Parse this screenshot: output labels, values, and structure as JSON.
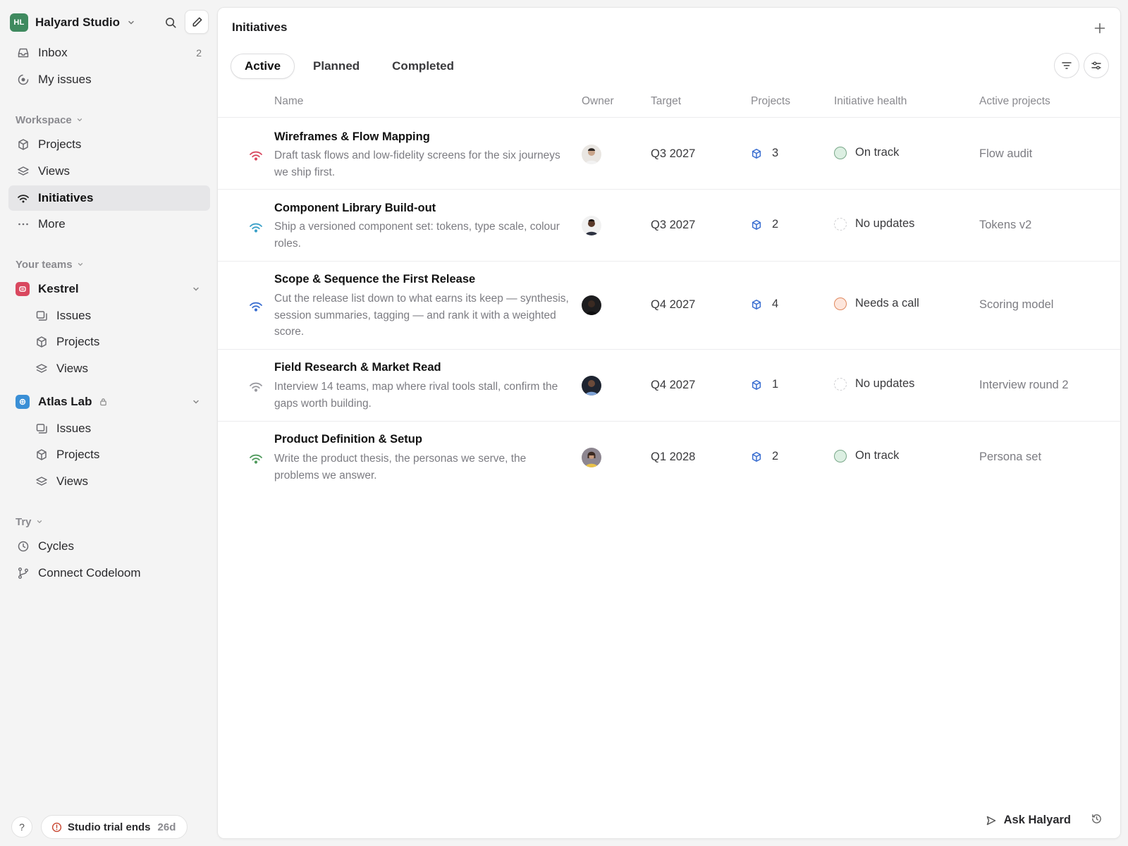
{
  "workspace": {
    "initials": "HL",
    "name": "Halyard Studio"
  },
  "nav": {
    "inbox": {
      "label": "Inbox",
      "count": "2"
    },
    "my_issues": {
      "label": "My issues"
    }
  },
  "sections": {
    "workspace": "Workspace",
    "your_teams": "Your teams",
    "try": "Try"
  },
  "workspace_items": {
    "projects": "Projects",
    "views": "Views",
    "initiatives": "Initiatives",
    "more": "More"
  },
  "teams": [
    {
      "name": "Kestrel",
      "color": "#d9485f",
      "items": [
        "Issues",
        "Projects",
        "Views"
      ]
    },
    {
      "name": "Atlas Lab",
      "color": "#3a8fd6",
      "items": [
        "Issues",
        "Projects",
        "Views"
      ]
    }
  ],
  "try_items": {
    "cycles": "Cycles",
    "connect": "Connect Codeloom"
  },
  "footer": {
    "help": "?",
    "trial_label": "Studio trial ends",
    "trial_days": "26d"
  },
  "main": {
    "title": "Initiatives",
    "tabs": [
      "Active",
      "Planned",
      "Completed"
    ],
    "columns": {
      "name": "Name",
      "owner": "Owner",
      "target": "Target",
      "projects": "Projects",
      "health": "Initiative health",
      "active": "Active projects"
    },
    "ask_label": "Ask Halyard"
  },
  "initiatives": [
    {
      "name": "Wireframes & Flow Mapping",
      "desc": "Draft task flows and low-fidelity screens for the six journeys we ship first.",
      "signal_color": "#d9485f",
      "target": "Q3 2027",
      "projects": "3",
      "health": "On track",
      "health_state": "green",
      "active": "Flow audit"
    },
    {
      "name": "Component Library Build-out",
      "desc": "Ship a versioned component set: tokens, type scale, colour roles.",
      "signal_color": "#3aa0c8",
      "target": "Q3 2027",
      "projects": "2",
      "health": "No updates",
      "health_state": "none",
      "active": "Tokens v2"
    },
    {
      "name": "Scope & Sequence the First Release",
      "desc": "Cut the release list down to what earns its keep — synthesis, session summaries, tagging — and rank it with a weighted score.",
      "signal_color": "#3b6fd1",
      "target": "Q4 2027",
      "projects": "4",
      "health": "Needs a call",
      "health_state": "orange",
      "active": "Scoring model"
    },
    {
      "name": "Field Research & Market Read",
      "desc": "Interview 14 teams, map where rival tools stall, confirm the gaps worth building.",
      "signal_color": "#9a9aa0",
      "target": "Q4 2027",
      "projects": "1",
      "health": "No updates",
      "health_state": "none",
      "active": "Interview round 2"
    },
    {
      "name": "Product Definition & Setup",
      "desc": "Write the product thesis, the personas we serve, the problems we answer.",
      "signal_color": "#4f9a5c",
      "target": "Q1 2028",
      "projects": "2",
      "health": "On track",
      "health_state": "green",
      "active": "Persona set"
    }
  ]
}
